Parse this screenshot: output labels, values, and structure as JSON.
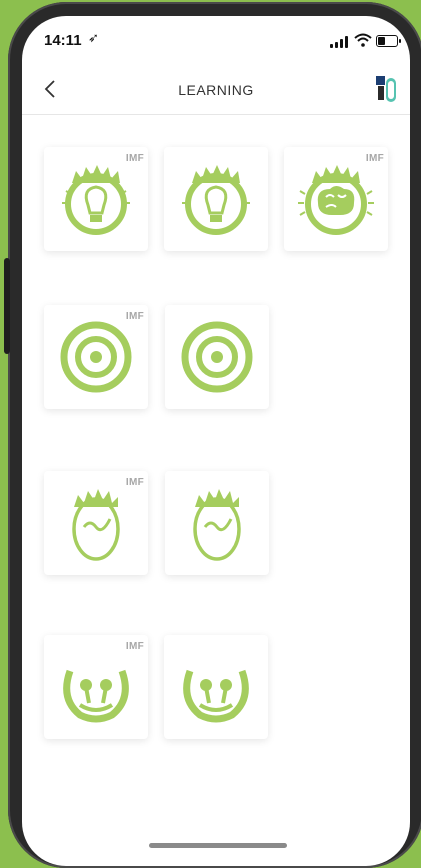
{
  "status_bar": {
    "time": "14:11",
    "location_arrow": "➶"
  },
  "nav": {
    "title": "LEARNING",
    "back_icon": "chevron-left-icon",
    "brand_icon": "brand-logo-icon"
  },
  "colors": {
    "accent": "#a5cd5e",
    "background": "#8cbf4e",
    "badge": "#a7a7a7"
  },
  "tiles": [
    {
      "icon": "lightbulb-icon",
      "badge": "IMF"
    },
    {
      "icon": "lightbulb-icon",
      "badge": ""
    },
    {
      "icon": "brain-icon",
      "badge": "IMF"
    },
    {
      "icon": "target-icon",
      "badge": "IMF"
    },
    {
      "icon": "target-icon",
      "badge": ""
    },
    {
      "icon": "face-icon",
      "badge": "IMF"
    },
    {
      "icon": "face-icon",
      "badge": ""
    },
    {
      "icon": "smile-icon",
      "badge": "IMF"
    },
    {
      "icon": "smile-icon",
      "badge": ""
    }
  ]
}
